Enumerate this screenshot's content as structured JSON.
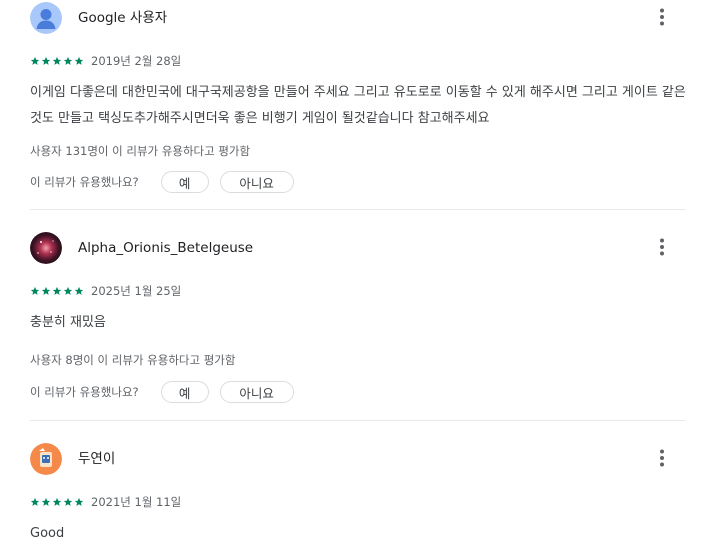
{
  "ui": {
    "star_color": "#01875f",
    "helpful_question": "이 리뷰가 유용했나요?",
    "yes_label": "예",
    "no_label": "아니요",
    "more_icon": "more-vert-icon"
  },
  "reviews": [
    {
      "author": "Google 사용자",
      "avatar": "default-person-avatar",
      "rating": 5,
      "date": "2019년 2월 28일",
      "text": "이게임 다좋은데 대한민국에 대구국제공항을 만들어 주세요 그리고 유도로로 이동할 수 있게 해주시면 그리고 게이트 같은것도 만들고 택싱도추가해주시면더욱 좋은 비행기 게임이 될것같습니다 참고해주세요",
      "helpful_count": "사용자 131명이 이 리뷰가 유용하다고 평가함"
    },
    {
      "author": "Alpha_Orionis_Betelgeuse",
      "avatar": "nebula-photo-avatar",
      "rating": 5,
      "date": "2025년 1월 25일",
      "text": "충분히 재밌음",
      "helpful_count": "사용자 8명이 이 리뷰가 유용하다고 평가함"
    },
    {
      "author": "두연이",
      "avatar": "orange-character-avatar",
      "rating": 5,
      "date": "2021년 1월 11일",
      "text": "Good"
    }
  ]
}
